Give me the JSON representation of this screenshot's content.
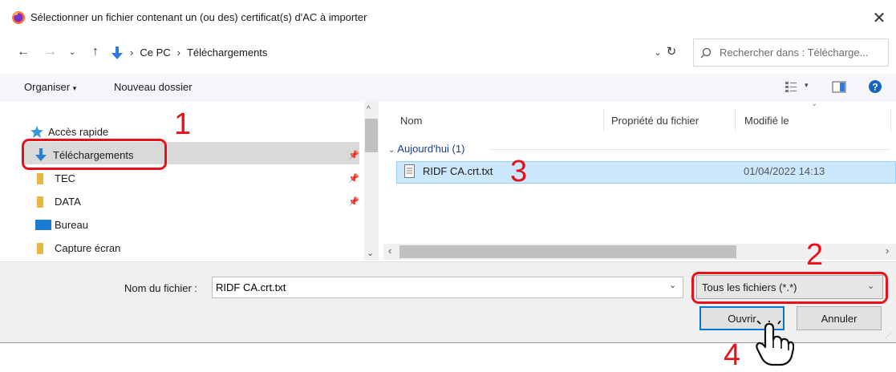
{
  "window": {
    "title": "Sélectionner un fichier contenant un (ou des) certificat(s) d'AC à importer"
  },
  "address": {
    "crumbs": [
      "Ce PC",
      "Téléchargements"
    ]
  },
  "search": {
    "placeholder": "Rechercher dans : Télécharge..."
  },
  "toolbar": {
    "organize_label": "Organiser",
    "new_folder_label": "Nouveau dossier"
  },
  "nav": {
    "items": [
      {
        "label": "Accès rapide",
        "icon": "star-icon"
      },
      {
        "label": "Téléchargements",
        "icon": "download-arrow-icon",
        "pinned": true,
        "selected": true
      },
      {
        "label": "TEC",
        "icon": "folder-icon",
        "pinned": true
      },
      {
        "label": "DATA",
        "icon": "folder-icon",
        "pinned": true
      },
      {
        "label": "Bureau",
        "icon": "desktop-icon"
      },
      {
        "label": "Capture écran",
        "icon": "folder-icon"
      }
    ]
  },
  "files": {
    "columns": [
      "Nom",
      "Propriété du fichier",
      "Modifié le"
    ],
    "group_label": "Aujourd'hui (1)",
    "rows": [
      {
        "name": "RIDF CA.crt.txt",
        "modified": "01/04/2022 14:13",
        "icon": "text-file-icon"
      }
    ]
  },
  "bottom": {
    "filename_label": "Nom du fichier :",
    "filename_value": "RIDF CA.crt.txt",
    "filetype_value": "Tous les fichiers (*.*)",
    "open_label": "Ouvrir",
    "cancel_label": "Annuler"
  },
  "annotations": {
    "step1": "1",
    "step2": "2",
    "step3": "3",
    "step4": "4",
    "color": "#e8111a"
  },
  "colors": {
    "selection": "#cce8ff",
    "accent": "#0078d7",
    "toolbar_bg": "#f4f6f9",
    "footer_bg": "#f0f0f0"
  }
}
